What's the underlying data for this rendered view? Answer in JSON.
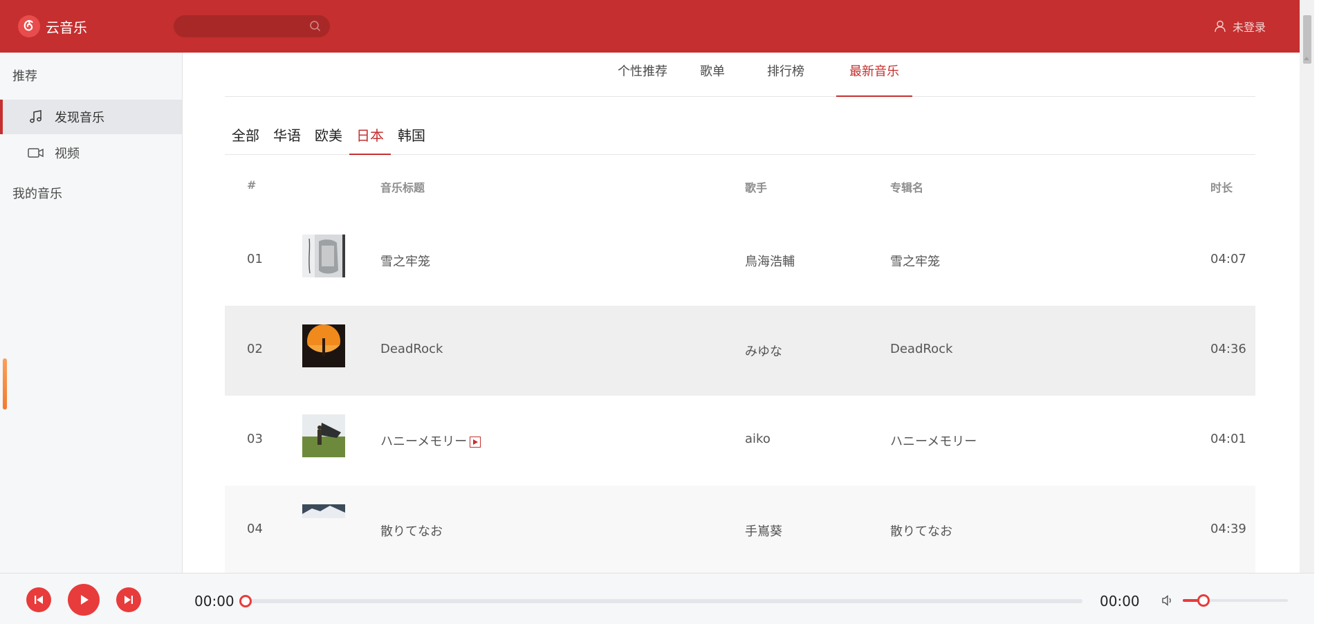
{
  "app": {
    "name": "云音乐",
    "brand_color": "#c62f2f"
  },
  "header": {
    "search_placeholder": "",
    "login_label": "未登录"
  },
  "sidebar": {
    "section_recommend": "推荐",
    "items": [
      {
        "label": "发现音乐",
        "icon": "music-note-icon",
        "active": true
      },
      {
        "label": "视频",
        "icon": "video-camera-icon",
        "active": false
      }
    ],
    "section_my_music": "我的音乐"
  },
  "nav_tabs": [
    {
      "label": "个性推荐",
      "active": false
    },
    {
      "label": "歌单",
      "active": false
    },
    {
      "label": "排行榜",
      "active": false
    },
    {
      "label": "最新音乐",
      "active": true
    }
  ],
  "categories": [
    {
      "label": "全部",
      "active": false
    },
    {
      "label": "华语",
      "active": false
    },
    {
      "label": "欧美",
      "active": false
    },
    {
      "label": "日本",
      "active": true
    },
    {
      "label": "韩国",
      "active": false
    }
  ],
  "table": {
    "headers": {
      "index": "#",
      "title": "音乐标题",
      "artist": "歌手",
      "album": "专辑名",
      "duration": "时长"
    },
    "rows": [
      {
        "index": "01",
        "title": "雪之牢笼",
        "artist": "鳥海浩輔",
        "album": "雪之牢笼",
        "duration": "04:07",
        "mv": false
      },
      {
        "index": "02",
        "title": "DeadRock",
        "artist": "みゆな",
        "album": "DeadRock",
        "duration": "04:36",
        "mv": false
      },
      {
        "index": "03",
        "title": "ハニーメモリー",
        "artist": "aiko",
        "album": "ハニーメモリー",
        "duration": "04:01",
        "mv": true
      },
      {
        "index": "04",
        "title": "散りてなお",
        "artist": "手嶌葵",
        "album": "散りてなお",
        "duration": "04:39",
        "mv": false
      }
    ]
  },
  "player": {
    "current_time": "00:00",
    "total_time": "00:00",
    "progress": 0,
    "volume": 0.2,
    "accent_color": "#e83b3b"
  }
}
